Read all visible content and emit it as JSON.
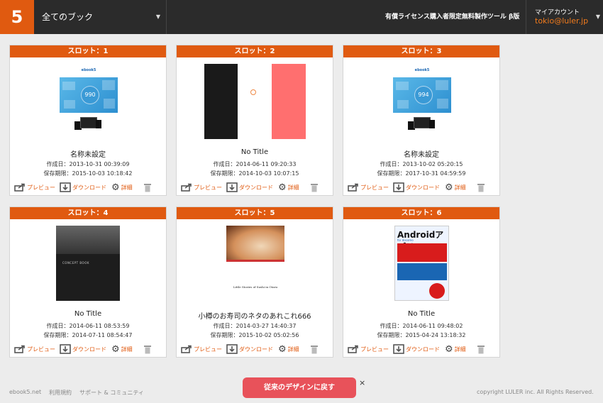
{
  "header": {
    "logo": "5",
    "book_selector": "全てのブック",
    "license_link": "有償ライセンス購入者限定無料製作ツール β版",
    "account_label": "マイアカウント",
    "account_email": "tokio@luler.jp"
  },
  "actions": {
    "preview": "プレビュー",
    "download": "ダウンロード",
    "detail": "詳細"
  },
  "labels": {
    "created": "作成日：",
    "expires": "保存期限："
  },
  "slots": [
    {
      "header": "スロット：1",
      "title": "名称未設定",
      "created": "2013-10-31 00:39:09",
      "expires": "2015-10-03 10:18:42",
      "thumb_brand": "ebook5",
      "thumb_number": "990"
    },
    {
      "header": "スロット：2",
      "title": "No Title",
      "created": "2014-06-11 09:20:33",
      "expires": "2014-10-03 10:07:15"
    },
    {
      "header": "スロット：3",
      "title": "名称未設定",
      "created": "2013-10-02 05:20:15",
      "expires": "2017-10-31 04:59:59",
      "thumb_brand": "ebook5",
      "thumb_number": "994"
    },
    {
      "header": "スロット：4",
      "title": "No Title",
      "created": "2014-06-11 08:53:59",
      "expires": "2014-07-11 08:54:47",
      "thumb_text": "CONCEPT BOOK"
    },
    {
      "header": "スロット：5",
      "title": "小樽のお寿司のネタのあれこれ666",
      "created": "2014-03-27 14:40:37",
      "expires": "2015-10-02 05:02:56",
      "thumb_text": "Little Stories of Sushi in Otaru"
    },
    {
      "header": "スロット：6",
      "title": "No Title",
      "created": "2014-06-11 09:48:02",
      "expires": "2015-04-24 13:18:32",
      "thumb_text": "Androidアプリ",
      "thumb_sub": "for docomo"
    }
  ],
  "footer": {
    "home": "ebook5.net",
    "terms": "利用規約",
    "support": "サポート & コミュニティ",
    "revert_button": "従来のデザインに戻す",
    "close": "×",
    "copyright": "copyright LULER inc. All Rights Reserved."
  },
  "colors": {
    "accent": "#e05a10",
    "header_bg": "#2b2b2b",
    "revert": "#e8525a"
  }
}
